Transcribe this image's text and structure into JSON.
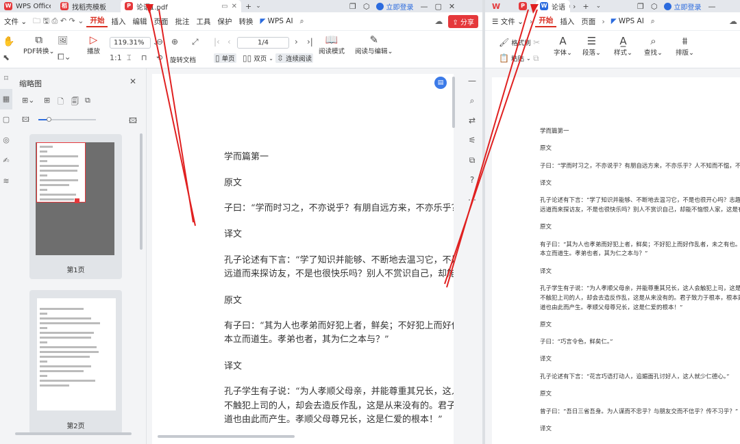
{
  "left": {
    "tabs": [
      "WPS Office",
      "找稻壳模板",
      "论语1.pdf"
    ],
    "login": "立即登录",
    "menu": {
      "file": "文件",
      "items": [
        "开始",
        "插入",
        "编辑",
        "页面",
        "批注",
        "工具",
        "保护",
        "转换"
      ],
      "ai": "WPS AI",
      "share": "分享"
    },
    "ribbon": {
      "pdf_convert": "PDF转换",
      "play": "播放",
      "zoom": "119.31%",
      "page": "1/4",
      "rotate": "旋转文档",
      "single": "单页",
      "double": "双页",
      "continuous": "连续阅读",
      "read_mode": "阅读模式",
      "read_edit": "阅读与编辑"
    },
    "thumb_title": "缩略图",
    "thumbs": [
      "第1页",
      "第2页"
    ],
    "doc": [
      "学而篇第一",
      "原文",
      "子曰：“学而时习之，不亦说乎？有朋自远方来，不亦乐乎？人",
      "译文",
      "孔子论述有下言：“学了知识并能够、不断地去温习它，不是也",
      "远道而来探访友，不是也很快乐吗？别人不赏识自己，却能不乐",
      "原文",
      "有子曰：“其为人也孝弟而好犯上者，鲜矣；不好犯上而好作乱",
      "本立而道生。孝弟也者，其为仁之本与？”",
      "译文",
      "孔子学生有子说：“为人孝顺父母亲，并能尊重其兄长，这人会",
      "不触犯上司的人，却会去造反作乱，这是从来没有的。君子致",
      "道也由此而产生。孝顺父母尊兄长，这是仁爱的根本！”"
    ]
  },
  "right": {
    "tab": "论语",
    "login": "立即登录",
    "menu": {
      "file": "文件",
      "items": [
        "开始",
        "插入",
        "页面"
      ],
      "ai": "WPS AI"
    },
    "ribbon": {
      "format_painter": "格式刷",
      "paste": "粘贴",
      "font": "字体",
      "paragraph": "段落",
      "style": "样式",
      "find": "查找",
      "layout": "排版"
    },
    "doc": [
      "学而篇第一",
      "原文",
      "子曰：“学而时习之，不亦说乎？有朋自远方来，不亦乐乎？人不知而不愠，不亦",
      "译文",
      "孔子论述有下言：“学了知识并能够、不断地去温习它，不是也很开心吗？志趣相",
      "远道而来探访友，不是也很快乐吗？别人不赏识自己，却能不恼恨人家，这是有修",
      "原文",
      "有子曰：“其为人也孝弟而好犯上者，鲜矣；不好犯上而好作乱者，未之有也。君",
      "本立而道生。孝弟也者，其为仁之本与？”",
      "译文",
      "孔子学生有子说：“为人孝顺父母亲，并能尊重其兄长，这人会触犯上司，这是很",
      "不触犯上司的人，却会去造反作乱，这是从来没有的。君子致力于根本，根本建",
      "道也由此而产生。孝顺父母尊兄长，这是仁爱的根本！”",
      "原文",
      "子曰：“巧言令色，鲜矣仁。”",
      "译文",
      "孔子论述有下言：“花言巧语打动人，追媚面孔讨好人，这人就少仁德心。”",
      "原文",
      "曾子曰：“吾日三省吾身。为人谋而不忠乎？与朋友交而不信乎？传不习乎？”",
      "译文"
    ]
  },
  "colors": {
    "accent": "#d92d20",
    "pdf": "#e5383b",
    "word": "#2b6bde",
    "link": "#2b6bde"
  }
}
